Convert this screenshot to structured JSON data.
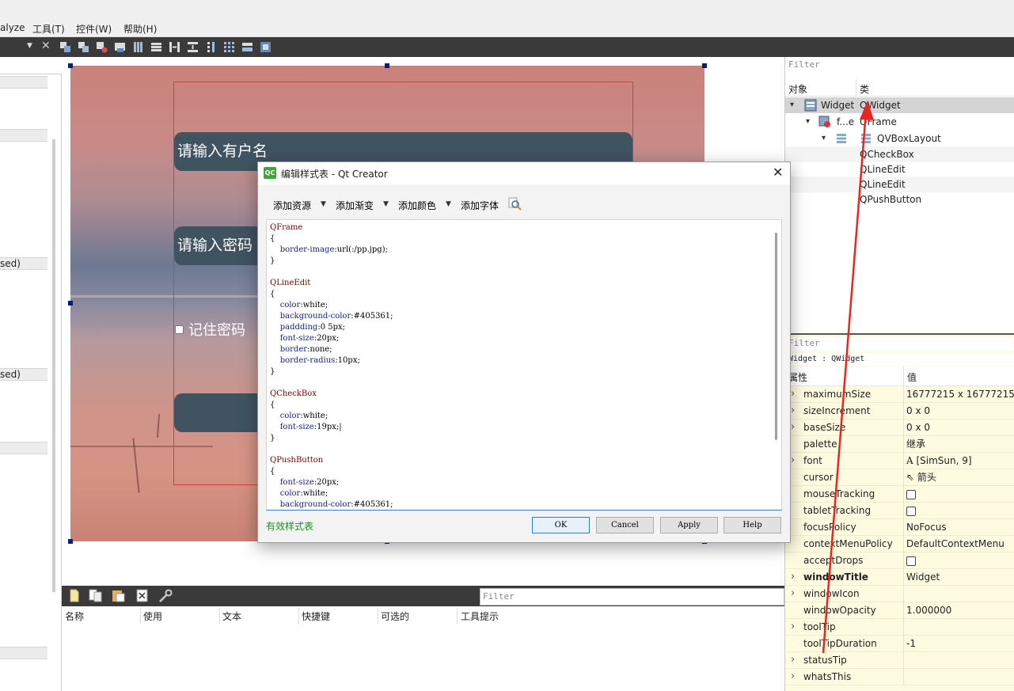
{
  "menubar": {
    "items": [
      "alyze",
      "工具(T)",
      "控件(W)",
      "帮助(H)"
    ]
  },
  "left_dock": {
    "labels": [
      "sed)",
      "sed)"
    ]
  },
  "form": {
    "username_placeholder": "请输入有户名",
    "password_placeholder": "请输入密码",
    "remember_label": "记住密码"
  },
  "bottom_editor": {
    "filter_placeholder": "Filter",
    "columns": [
      "名称",
      "使用",
      "文本",
      "快捷键",
      "可选的",
      "工具提示"
    ]
  },
  "object_inspector": {
    "filter_placeholder": "Filter",
    "col_object": "对象",
    "col_class": "类",
    "rows": [
      {
        "object": "Widget",
        "class": "QWidget"
      },
      {
        "object": "f...e",
        "class": "QFrame"
      },
      {
        "object": "",
        "class": "QVBoxLayout"
      },
      {
        "object": "",
        "class": "QCheckBox"
      },
      {
        "object": "",
        "class": "QLineEdit"
      },
      {
        "object": "",
        "class": "QLineEdit"
      },
      {
        "object": "",
        "class": "QPushButton"
      }
    ]
  },
  "property_editor": {
    "filter_placeholder": "Filter",
    "context": "Widget : QWidget",
    "col_property": "属性",
    "col_value": "值",
    "rows": [
      {
        "name": "maximumSize",
        "value": "16777215 x 16777215",
        "expandable": true,
        "bold": false
      },
      {
        "name": "sizeIncrement",
        "value": "0 x 0",
        "expandable": true,
        "bold": false
      },
      {
        "name": "baseSize",
        "value": "0 x 0",
        "expandable": true,
        "bold": false
      },
      {
        "name": "palette",
        "value": "继承",
        "expandable": false,
        "bold": false
      },
      {
        "name": "font",
        "value": "[SimSun, 9]",
        "expandable": true,
        "bold": false,
        "icon": "A"
      },
      {
        "name": "cursor",
        "value": "箭头",
        "expandable": false,
        "bold": false,
        "icon": "cursor"
      },
      {
        "name": "mouseTracking",
        "value": "",
        "expandable": false,
        "bold": false,
        "checkbox": true
      },
      {
        "name": "tabletTracking",
        "value": "",
        "expandable": false,
        "bold": false,
        "checkbox": true
      },
      {
        "name": "focusPolicy",
        "value": "NoFocus",
        "expandable": false,
        "bold": false
      },
      {
        "name": "contextMenuPolicy",
        "value": "DefaultContextMenu",
        "expandable": false,
        "bold": false
      },
      {
        "name": "acceptDrops",
        "value": "",
        "expandable": false,
        "bold": false,
        "checkbox": true
      },
      {
        "name": "windowTitle",
        "value": "Widget",
        "expandable": true,
        "bold": true
      },
      {
        "name": "windowIcon",
        "value": "",
        "expandable": true,
        "bold": false
      },
      {
        "name": "windowOpacity",
        "value": "1.000000",
        "expandable": false,
        "bold": false
      },
      {
        "name": "toolTip",
        "value": "",
        "expandable": true,
        "bold": false
      },
      {
        "name": "toolTipDuration",
        "value": "-1",
        "expandable": false,
        "bold": false
      },
      {
        "name": "statusTip",
        "value": "",
        "expandable": true,
        "bold": false
      },
      {
        "name": "whatsThis",
        "value": "",
        "expandable": true,
        "bold": false
      }
    ]
  },
  "dialog": {
    "title": "编辑样式表 - Qt Creator",
    "tools": [
      "添加资源",
      "添加渐变",
      "添加颜色",
      "添加字体"
    ],
    "status": "有效样式表",
    "buttons": {
      "ok": "OK",
      "cancel": "Cancel",
      "apply": "Apply",
      "help": "Help"
    },
    "code": [
      [
        {
          "t": "sel",
          "v": "QFrame"
        }
      ],
      [
        {
          "t": "plain",
          "v": "{"
        }
      ],
      [
        {
          "t": "plain",
          "v": "    "
        },
        {
          "t": "prop",
          "v": "border-image"
        },
        {
          "t": "plain",
          "v": ":url(:/pp.jpg);"
        }
      ],
      [
        {
          "t": "plain",
          "v": "}"
        }
      ],
      [],
      [
        {
          "t": "sel",
          "v": "QLineEdit"
        }
      ],
      [
        {
          "t": "plain",
          "v": "{"
        }
      ],
      [
        {
          "t": "plain",
          "v": "    "
        },
        {
          "t": "prop",
          "v": "color"
        },
        {
          "t": "plain",
          "v": ":white;"
        }
      ],
      [
        {
          "t": "plain",
          "v": "    "
        },
        {
          "t": "prop",
          "v": "background-color"
        },
        {
          "t": "plain",
          "v": ":#405361;"
        }
      ],
      [
        {
          "t": "plain",
          "v": "    "
        },
        {
          "t": "prop",
          "v": "paddding"
        },
        {
          "t": "plain",
          "v": ":0 5px;"
        }
      ],
      [
        {
          "t": "plain",
          "v": "    "
        },
        {
          "t": "prop",
          "v": "font-size"
        },
        {
          "t": "plain",
          "v": ":20px;"
        }
      ],
      [
        {
          "t": "plain",
          "v": "    "
        },
        {
          "t": "prop",
          "v": "border"
        },
        {
          "t": "plain",
          "v": ":none;"
        }
      ],
      [
        {
          "t": "plain",
          "v": "    "
        },
        {
          "t": "prop",
          "v": "border-radius"
        },
        {
          "t": "plain",
          "v": ":10px;"
        }
      ],
      [
        {
          "t": "plain",
          "v": "}"
        }
      ],
      [],
      [
        {
          "t": "sel",
          "v": "QCheckBox"
        }
      ],
      [
        {
          "t": "plain",
          "v": "{"
        }
      ],
      [
        {
          "t": "plain",
          "v": "    "
        },
        {
          "t": "prop",
          "v": "color"
        },
        {
          "t": "plain",
          "v": ":white;"
        }
      ],
      [
        {
          "t": "plain",
          "v": "    "
        },
        {
          "t": "prop",
          "v": "font-size"
        },
        {
          "t": "plain",
          "v": ":19px;|"
        }
      ],
      [
        {
          "t": "plain",
          "v": "}"
        }
      ],
      [],
      [
        {
          "t": "sel",
          "v": "QPushButton"
        }
      ],
      [
        {
          "t": "plain",
          "v": "{"
        }
      ],
      [
        {
          "t": "plain",
          "v": "    "
        },
        {
          "t": "prop",
          "v": "font-size"
        },
        {
          "t": "plain",
          "v": ":20px;"
        }
      ],
      [
        {
          "t": "plain",
          "v": "    "
        },
        {
          "t": "prop",
          "v": "color"
        },
        {
          "t": "plain",
          "v": ":white;"
        }
      ],
      [
        {
          "t": "plain",
          "v": "    "
        },
        {
          "t": "prop",
          "v": "background-color"
        },
        {
          "t": "plain",
          "v": ":#405361;"
        }
      ]
    ]
  }
}
